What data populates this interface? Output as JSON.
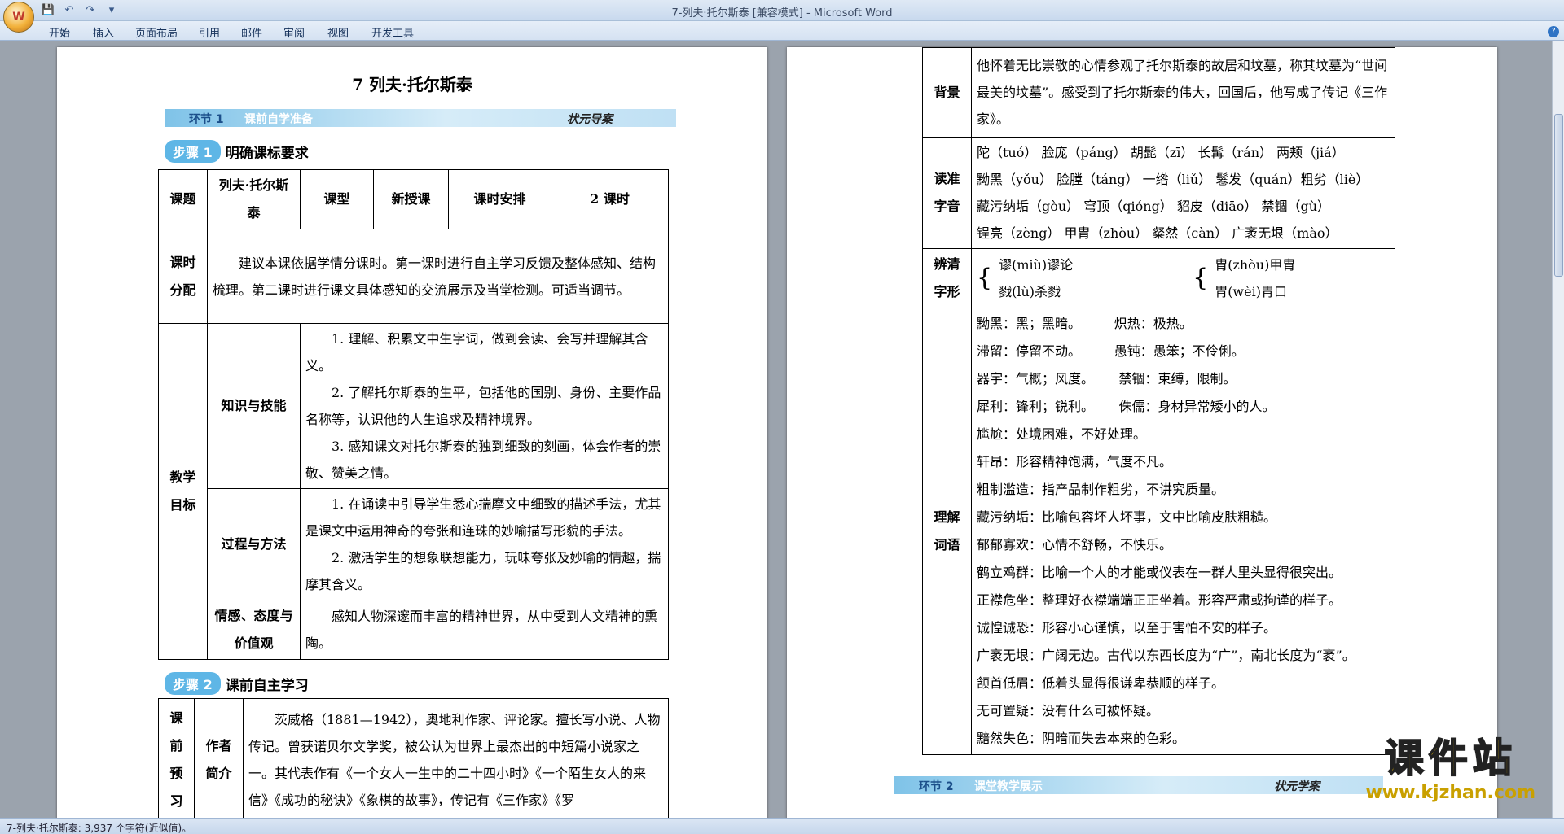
{
  "window": {
    "title": "7-列夫·托尔斯泰 [兼容模式] - Microsoft Word"
  },
  "quick_access": [
    "save-icon",
    "undo-icon",
    "redo-icon",
    "customize-icon"
  ],
  "menu": [
    "开始",
    "插入",
    "页面布局",
    "引用",
    "邮件",
    "审阅",
    "视图",
    "开发工具"
  ],
  "status": {
    "text": "7-列夫·托尔斯泰: 3,937 个字符(近似值)。"
  },
  "left": {
    "doc_title": "7  列夫·托尔斯泰",
    "banner": {
      "part1": "环节 1",
      "part2": "课前自学准备",
      "part3": "状元导案"
    },
    "step1": {
      "pill": "步骤 1",
      "text": "明确课标要求"
    },
    "table1": {
      "r1": [
        "课题",
        "列夫·托尔斯泰",
        "课型",
        "新授课",
        "课时安排",
        "2 课时"
      ],
      "alloc_label": "课时分配",
      "alloc_text": "建议本课依据学情分课时。第一课时进行自主学习反馈及整体感知、结构梳理。第二课时进行课文具体感知的交流展示及当堂检测。可适当调节。",
      "goal_label": "教学目标",
      "k_label": "知识与技能",
      "k1": "1. 理解、积累文中生字词，做到会读、会写并理解其含义。",
      "k2": "2. 了解托尔斯泰的生平，包括他的国别、身份、主要作品名称等，认识他的人生追求及精神境界。",
      "k3": "3. 感知课文对托尔斯泰的独到细致的刻画，体会作者的崇敬、赞美之情。",
      "p_label": "过程与方法",
      "p1": "1. 在诵读中引导学生悉心揣摩文中细致的描述手法，尤其是课文中运用神奇的夸张和连珠的妙喻描写形貌的手法。",
      "p2": "2. 激活学生的想象联想能力，玩味夸张及妙喻的情趣，揣摩其含义。",
      "e_label": "情感、态度与价值观",
      "e1": "感知人物深邃而丰富的精神世界，从中受到人文精神的熏陶。"
    },
    "step2": {
      "pill": "步骤 2",
      "text": "课前自主学习"
    },
    "table2": {
      "label": "课前预习",
      "sub": "作者简介",
      "text": "茨威格（1881—1942），奥地利作家、评论家。擅长写小说、人物传记。曾获诺贝尔文学奖，被公认为世界上最杰出的中短篇小说家之一。其代表作有《一个女人一生中的二十四小时》《一个陌生女人的来信》《成功的秘诀》《象棋的故事》，传记有《三作家》《罗"
    }
  },
  "right": {
    "bg_label": "背景",
    "bg_text": "他怀着无比崇敬的心情参观了托尔斯泰的故居和坟墓，称其坟墓为“世间最美的坟墓”。感受到了托尔斯泰的伟大，回国后，他写成了传记《三作家》。",
    "read_label": "读准字音",
    "read_lines": [
      "陀（tuó） 脸庞（páng） 胡髭（zī） 长髯（rán） 两颊（jiá）",
      "黝黑（yǒu） 脸膛（táng） 一绺（liǔ） 鬈发（quán）粗劣（liè）",
      "藏污纳垢（gòu） 穹顶（qióng） 貂皮（diāo） 禁锢（gù）",
      "锃亮（zèng） 甲胄（zhòu） 粲然（càn） 广袤无垠（mào）"
    ],
    "dist_label": "辨清字形",
    "dist": [
      "谬(miù)谬论",
      "戮(lù)杀戮",
      "胄(zhòu)甲胄",
      "胃(wèi)胃口"
    ],
    "vocab_label": "理解词语",
    "vocab": [
      "黝黑：黑；黑暗。        炽热：极热。",
      "滞留：停留不动。        愚钝：愚笨；不伶俐。",
      "器宇：气概；风度。      禁锢：束缚，限制。",
      "犀利：锋利；锐利。      侏儒：身材异常矮小的人。",
      "尴尬：处境困难，不好处理。",
      "轩昂：形容精神饱满，气度不凡。",
      "粗制滥造：指产品制作粗劣，不讲究质量。",
      "藏污纳垢：比喻包容坏人坏事，文中比喻皮肤粗糙。",
      "郁郁寡欢：心情不舒畅，不快乐。",
      "鹤立鸡群：比喻一个人的才能或仪表在一群人里头显得很突出。",
      "正襟危坐：整理好衣襟端端正正坐着。形容严肃或拘谨的样子。",
      "诚惶诚恐：形容小心谨慎，以至于害怕不安的样子。",
      "广袤无垠：广阔无边。古代以东西长度为“广”，南北长度为“袤”。",
      "颔首低眉：低着头显得很谦卑恭顺的样子。",
      "无可置疑：没有什么可被怀疑。",
      "黯然失色：阴暗而失去本来的色彩。"
    ],
    "banner2": {
      "part1": "环节 2",
      "part2": "课堂教学展示",
      "part3": "状元学案"
    },
    "watermark": {
      "line1": "课件站",
      "line2": "www.kjzhan.com"
    }
  }
}
